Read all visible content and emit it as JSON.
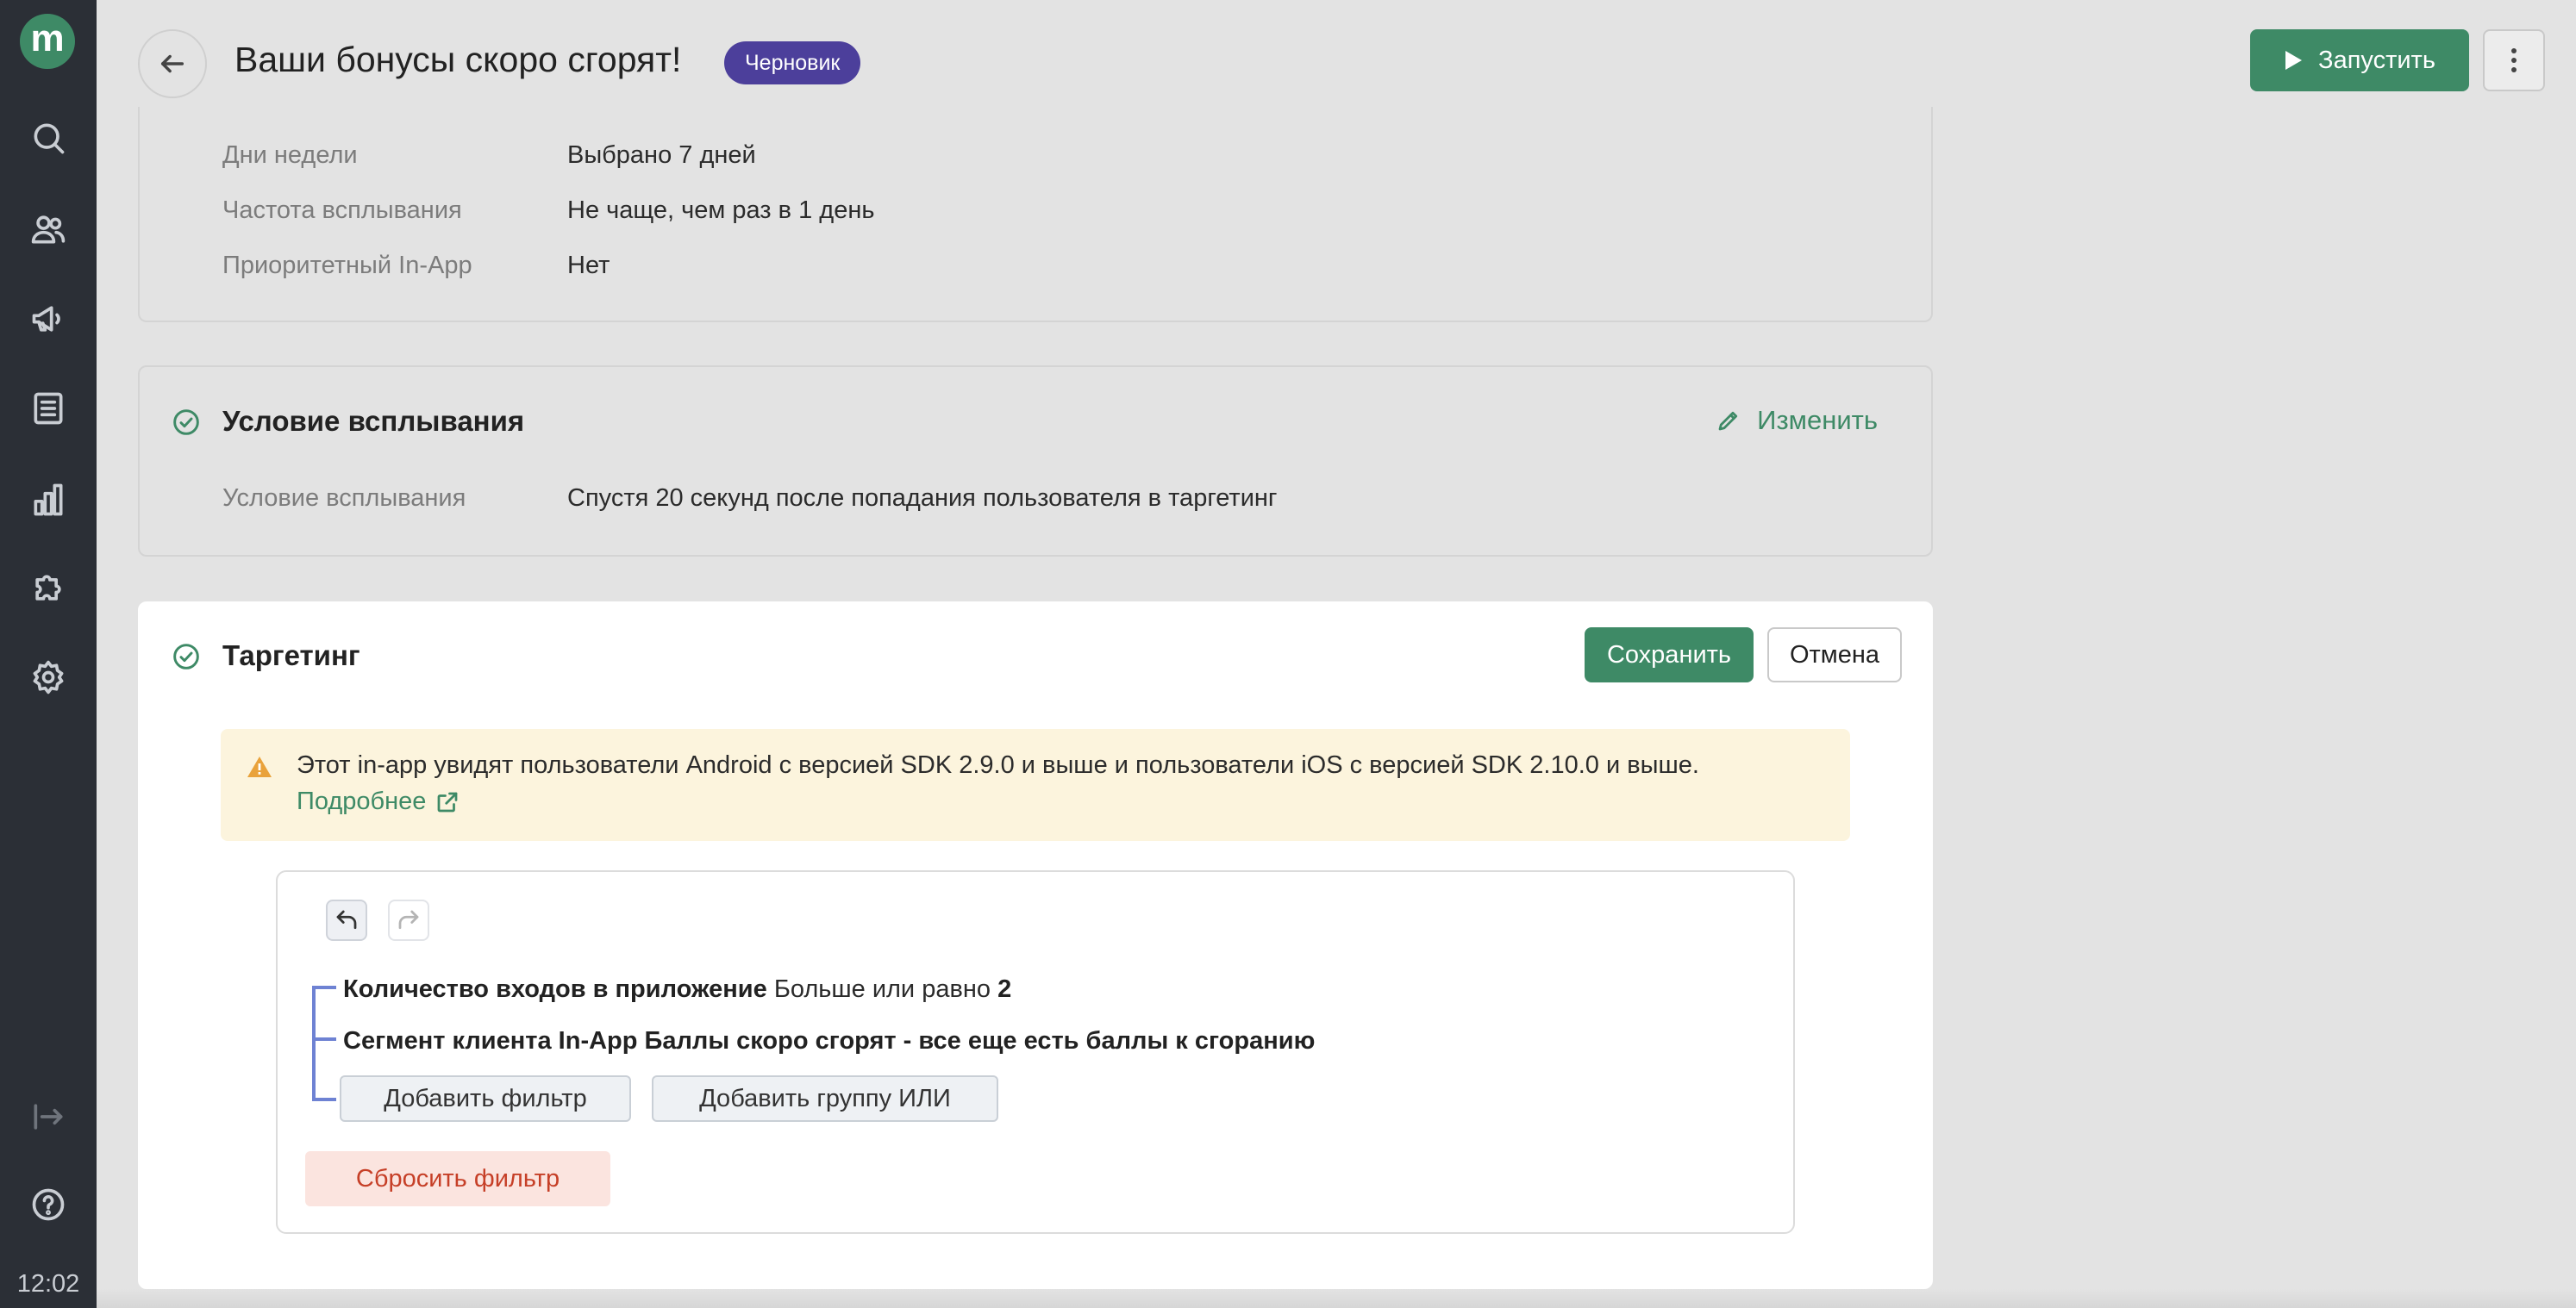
{
  "sidebar": {
    "logo_letter": "m",
    "icons": [
      "search-icon",
      "users-icon",
      "megaphone-icon",
      "list-icon",
      "chart-icon",
      "puzzle-icon",
      "gear-icon",
      "logout-icon",
      "help-icon"
    ],
    "clock": "12:02"
  },
  "header": {
    "title": "Ваши бонусы скоро сгорят!",
    "badge": "Черновик",
    "run_label": "Запустить"
  },
  "schedule": {
    "rows": [
      {
        "label": "Дни недели",
        "value": "Выбрано 7 дней"
      },
      {
        "label": "Частота всплывания",
        "value": "Не чаще, чем раз в 1 день"
      },
      {
        "label": "Приоритетный In-App",
        "value": "Нет"
      }
    ]
  },
  "trigger": {
    "title": "Условие всплывания",
    "edit_label": "Изменить",
    "row_label": "Условие всплывания",
    "row_value": "Спустя 20 секунд после попадания пользователя в таргетинг"
  },
  "targeting": {
    "title": "Таргетинг",
    "save_label": "Сохранить",
    "cancel_label": "Отмена",
    "warning_text": "Этот in-app увидят пользователи Android с версией SDK 2.9.0 и выше и пользователи iOS с версией SDK 2.10.0 и выше.",
    "more_label": "Подробнее",
    "filters": [
      {
        "name": "Количество входов в приложение",
        "op": "Больше или равно",
        "value": "2"
      },
      {
        "name": "Сегмент клиента",
        "value": "In-App Баллы скоро сгорят - все еще есть баллы к сгоранию"
      }
    ],
    "add_filter_label": "Добавить фильтр",
    "add_or_group_label": "Добавить группу ИЛИ",
    "reset_label": "Сбросить фильтр"
  },
  "colors": {
    "accent": "#3e8a66",
    "badge": "#4c3f9b",
    "sidebar": "#2b2f36",
    "warning_bg": "#fcf4dd",
    "reset": "#c63f27"
  }
}
